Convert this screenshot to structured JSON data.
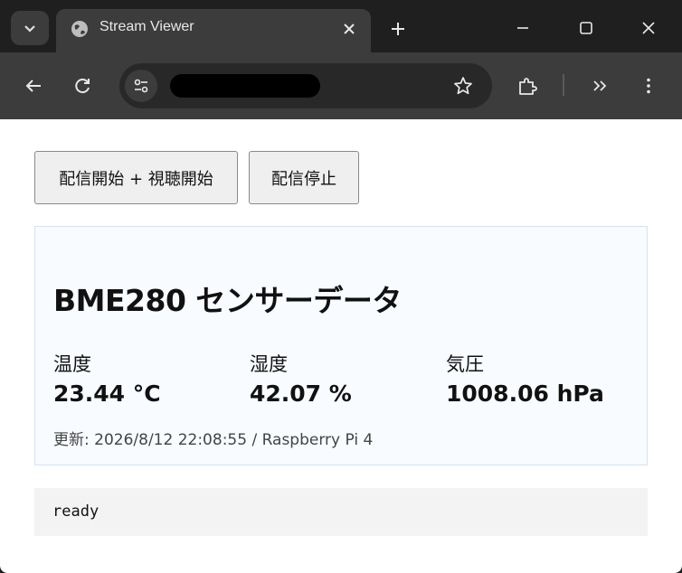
{
  "tab": {
    "title": "Stream Viewer"
  },
  "colors": {
    "tabstrip": "#1f1f1f",
    "toolbar": "#3c3c3c",
    "omnibox": "#282828",
    "panel_bg": "#f8fbff",
    "panel_border": "#d6e4f0"
  },
  "icons": {
    "tab_search": "chevron-down-icon",
    "favicon": "globe-icon",
    "close": "close-icon",
    "new_tab": "plus-icon",
    "minimize": "minimize-icon",
    "maximize": "maximize-icon",
    "window_close": "close-icon",
    "back": "back-arrow-icon",
    "reload": "reload-icon",
    "site_info": "tune-icon",
    "bookmark": "star-icon",
    "extensions": "puzzle-icon",
    "more_tools": "double-chevron-icon",
    "menu": "kebab-menu-icon"
  },
  "buttons": {
    "start": "配信開始 + 視聴開始",
    "stop": "配信停止"
  },
  "sensor": {
    "title": "BME280 センサーデータ",
    "temperature": {
      "label": "温度",
      "value": "23.44 °C"
    },
    "humidity": {
      "label": "湿度",
      "value": "42.07 %"
    },
    "pressure": {
      "label": "気圧",
      "value": "1008.06 hPa"
    },
    "updated": "更新: 2026/8/12 22:08:55 / Raspberry Pi 4"
  },
  "status": {
    "text": "ready"
  }
}
